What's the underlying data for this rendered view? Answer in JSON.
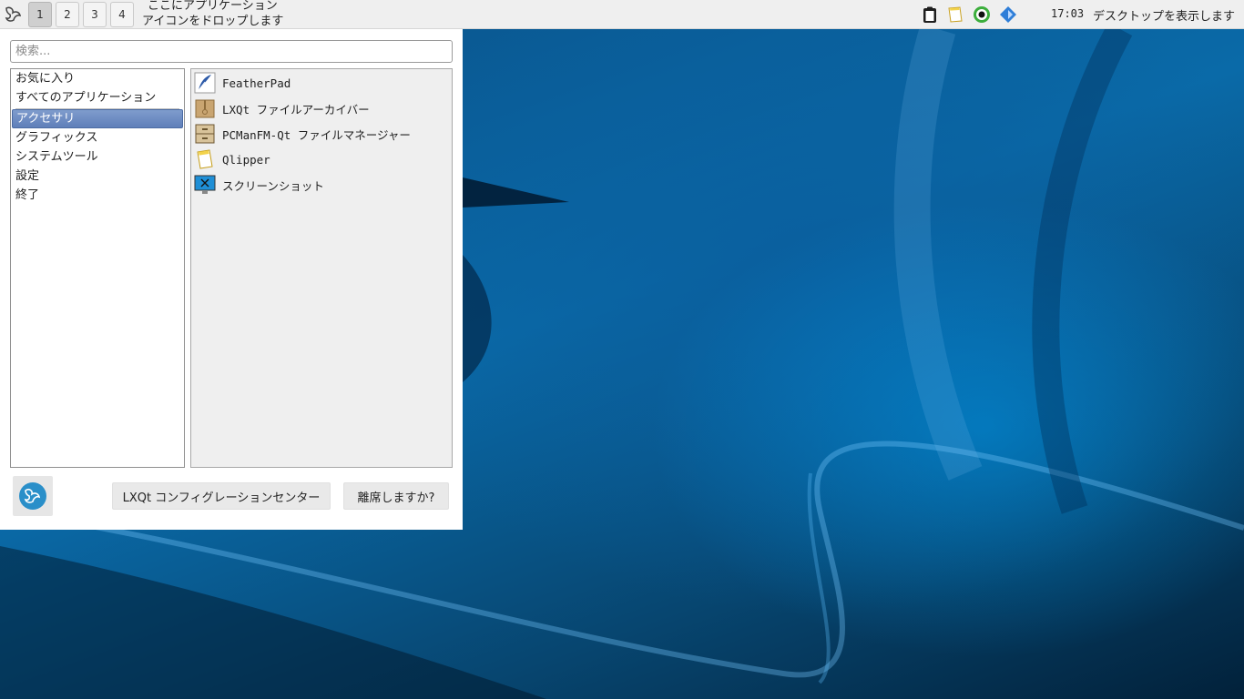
{
  "panel": {
    "workspaces": [
      "1",
      "2",
      "3",
      "4"
    ],
    "active_workspace": "1",
    "quicklaunch_hint_line1": "ここにアプリケーション",
    "quicklaunch_hint_line2": "アイコンをドロップします",
    "tray_icons": [
      "clipboard-icon",
      "notes-icon",
      "record-icon",
      "network-icon"
    ],
    "clock": "17:03",
    "show_desktop": "デスクトップを表示します"
  },
  "menu": {
    "search_placeholder": "検索...",
    "categories": [
      {
        "label": "お気に入り"
      },
      {
        "label": "すべてのアプリケーション"
      },
      {
        "label": "アクセサリ",
        "selected": true
      },
      {
        "label": "グラフィックス"
      },
      {
        "label": "システムツール"
      },
      {
        "label": "設定"
      },
      {
        "label": "終了"
      }
    ],
    "apps": [
      {
        "label": "FeatherPad",
        "icon": "featherpad-icon"
      },
      {
        "label": "LXQt ファイルアーカイバー",
        "icon": "archiver-icon"
      },
      {
        "label": "PCManFM-Qt ファイルマネージャー",
        "icon": "file-manager-icon"
      },
      {
        "label": "Qlipper",
        "icon": "qlipper-icon"
      },
      {
        "label": "スクリーンショット",
        "icon": "screenshot-icon"
      }
    ],
    "config_center_button": "LXQt コンフィグレーションセンター",
    "leave_button": "離席しますか?"
  },
  "colors": {
    "panel_bg": "#efefef",
    "selection": "#6a89c2",
    "desktop": "#0a6aa8"
  }
}
